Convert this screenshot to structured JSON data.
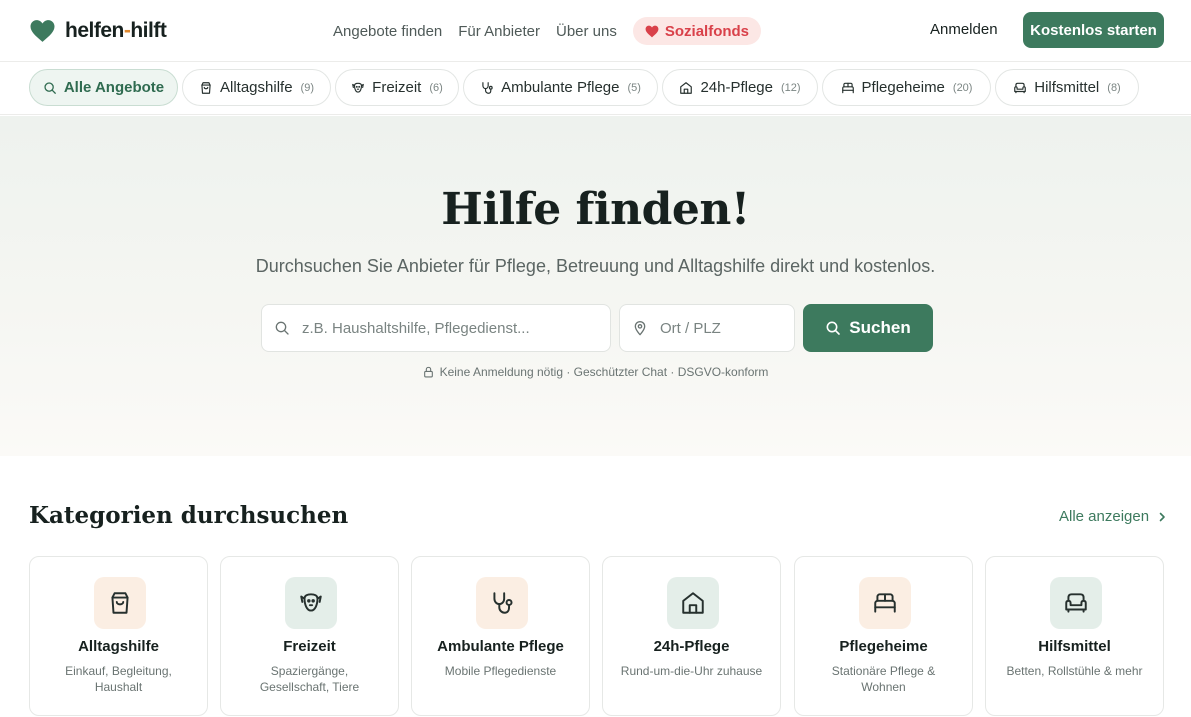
{
  "brand": {
    "name_part1": "helfen",
    "name_dash": "-",
    "name_part2": "hilft",
    "accent": "#3d7a5e",
    "dash_color": "#e0892f"
  },
  "nav": {
    "links": [
      "Angebote finden",
      "Für Anbieter",
      "Über uns"
    ],
    "sozialfonds": "Sozialfonds",
    "login": "Anmelden",
    "cta": "Kostenlos starten"
  },
  "chips": [
    {
      "label": "Alle Angebote",
      "count": "",
      "icon": "search-icon",
      "active": true
    },
    {
      "label": "Alltagshilfe",
      "count": "(9)",
      "icon": "shopping-bag-icon"
    },
    {
      "label": "Freizeit",
      "count": "(6)",
      "icon": "dog-icon"
    },
    {
      "label": "Ambulante Pflege",
      "count": "(5)",
      "icon": "stethoscope-icon"
    },
    {
      "label": "24h-Pflege",
      "count": "(12)",
      "icon": "home-icon"
    },
    {
      "label": "Pflegeheime",
      "count": "(20)",
      "icon": "bed-icon"
    },
    {
      "label": "Hilfsmittel",
      "count": "(8)",
      "icon": "armchair-icon"
    }
  ],
  "hero": {
    "title": "Hilfe finden!",
    "subtitle": "Durchsuchen Sie Anbieter für Pflege, Betreuung und Alltagshilfe direkt und kostenlos.",
    "what_placeholder": "z.B. Haushaltshilfe, Pflegedienst...",
    "what_value": "",
    "where_placeholder": "Ort / PLZ",
    "where_value": "",
    "search_button": "Suchen",
    "trust": "Keine Anmeldung nötig · Geschützter Chat · DSGVO-konform"
  },
  "categories": {
    "title": "Kategorien durchsuchen",
    "show_all": "Alle anzeigen",
    "items": [
      {
        "name": "Alltagshilfe",
        "desc": "Einkauf, Begleitung, Haushalt",
        "icon": "shopping-bag-icon",
        "tone": "warm"
      },
      {
        "name": "Freizeit",
        "desc": "Spaziergänge, Gesellschaft, Tiere",
        "icon": "dog-icon",
        "tone": "cool"
      },
      {
        "name": "Ambulante Pflege",
        "desc": "Mobile Pflegedienste",
        "icon": "stethoscope-icon",
        "tone": "warm"
      },
      {
        "name": "24h-Pflege",
        "desc": "Rund-um-die-Uhr zuhause",
        "icon": "home-icon",
        "tone": "cool"
      },
      {
        "name": "Pflegeheime",
        "desc": "Stationäre Pflege & Wohnen",
        "icon": "bed-icon",
        "tone": "warm"
      },
      {
        "name": "Hilfsmittel",
        "desc": "Betten, Rollstühle & mehr",
        "icon": "armchair-icon",
        "tone": "cool"
      }
    ]
  }
}
